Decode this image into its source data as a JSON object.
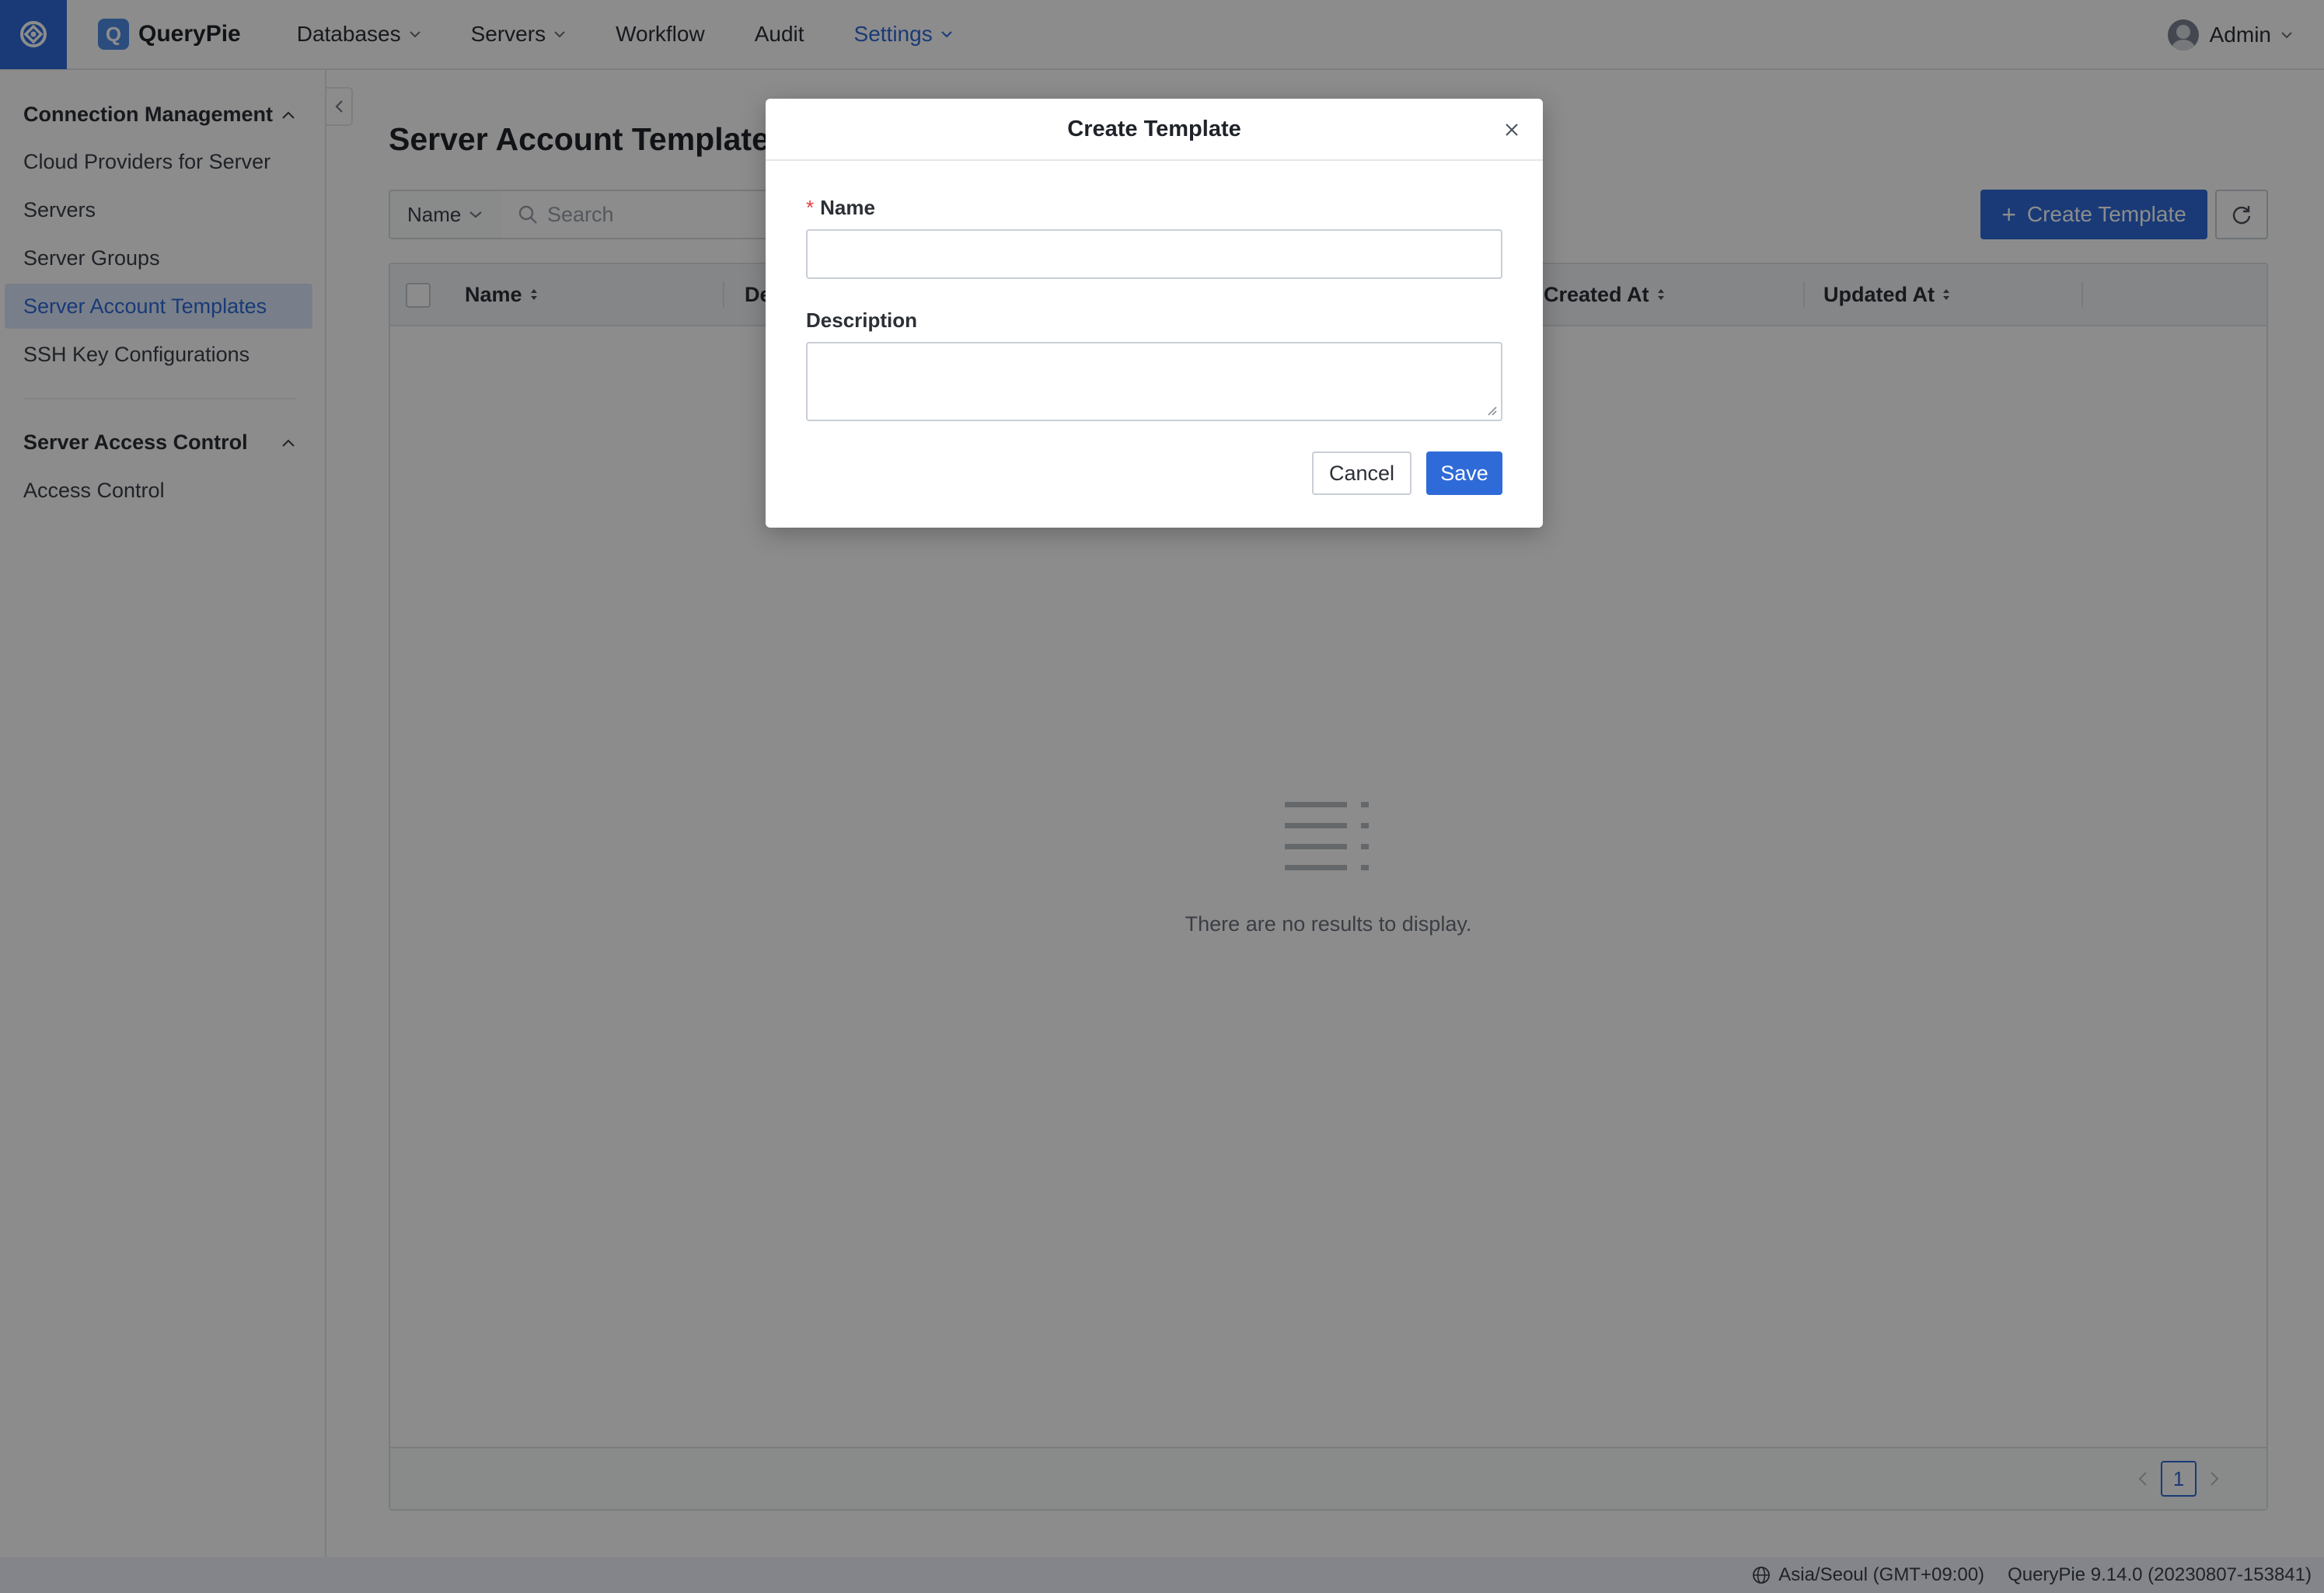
{
  "brand": {
    "name": "QueryPie",
    "logo_letter": "Q"
  },
  "nav": {
    "items": [
      {
        "label": "Databases",
        "has_dropdown": true
      },
      {
        "label": "Servers",
        "has_dropdown": true
      },
      {
        "label": "Workflow",
        "has_dropdown": false
      },
      {
        "label": "Audit",
        "has_dropdown": false
      },
      {
        "label": "Settings",
        "has_dropdown": true,
        "active": true
      }
    ],
    "user": "Admin"
  },
  "sidebar": {
    "sections": [
      {
        "title": "Connection Management",
        "expanded": true,
        "items": [
          {
            "label": "Cloud Providers for Server"
          },
          {
            "label": "Servers"
          },
          {
            "label": "Server Groups"
          },
          {
            "label": "Server Account Templates",
            "active": true
          },
          {
            "label": "SSH Key Configurations"
          }
        ]
      },
      {
        "title": "Server Access Control",
        "expanded": true,
        "items": [
          {
            "label": "Access Control"
          }
        ]
      }
    ]
  },
  "page": {
    "title": "Server Account Templates",
    "filter_field": "Name",
    "search_placeholder": "Search",
    "create_button": "Create Template",
    "table": {
      "columns": [
        "Name",
        "De",
        "Created At",
        "Updated At"
      ],
      "rows": [],
      "empty_message": "There are no results to display.",
      "current_page": "1"
    }
  },
  "statusbar": {
    "timezone": "Asia/Seoul (GMT+09:00)",
    "version": "QueryPie 9.14.0 (20230807-153841)"
  },
  "modal": {
    "title": "Create Template",
    "name_required_mark": "*",
    "name_label": "Name",
    "name_value": "",
    "description_label": "Description",
    "description_value": "",
    "cancel_label": "Cancel",
    "save_label": "Save"
  },
  "colors": {
    "accent": "#2f6bd8",
    "active_item_bg": "#dbe7fb",
    "required": "#e04040",
    "overlay": "rgba(0,0,0,0.45)"
  }
}
